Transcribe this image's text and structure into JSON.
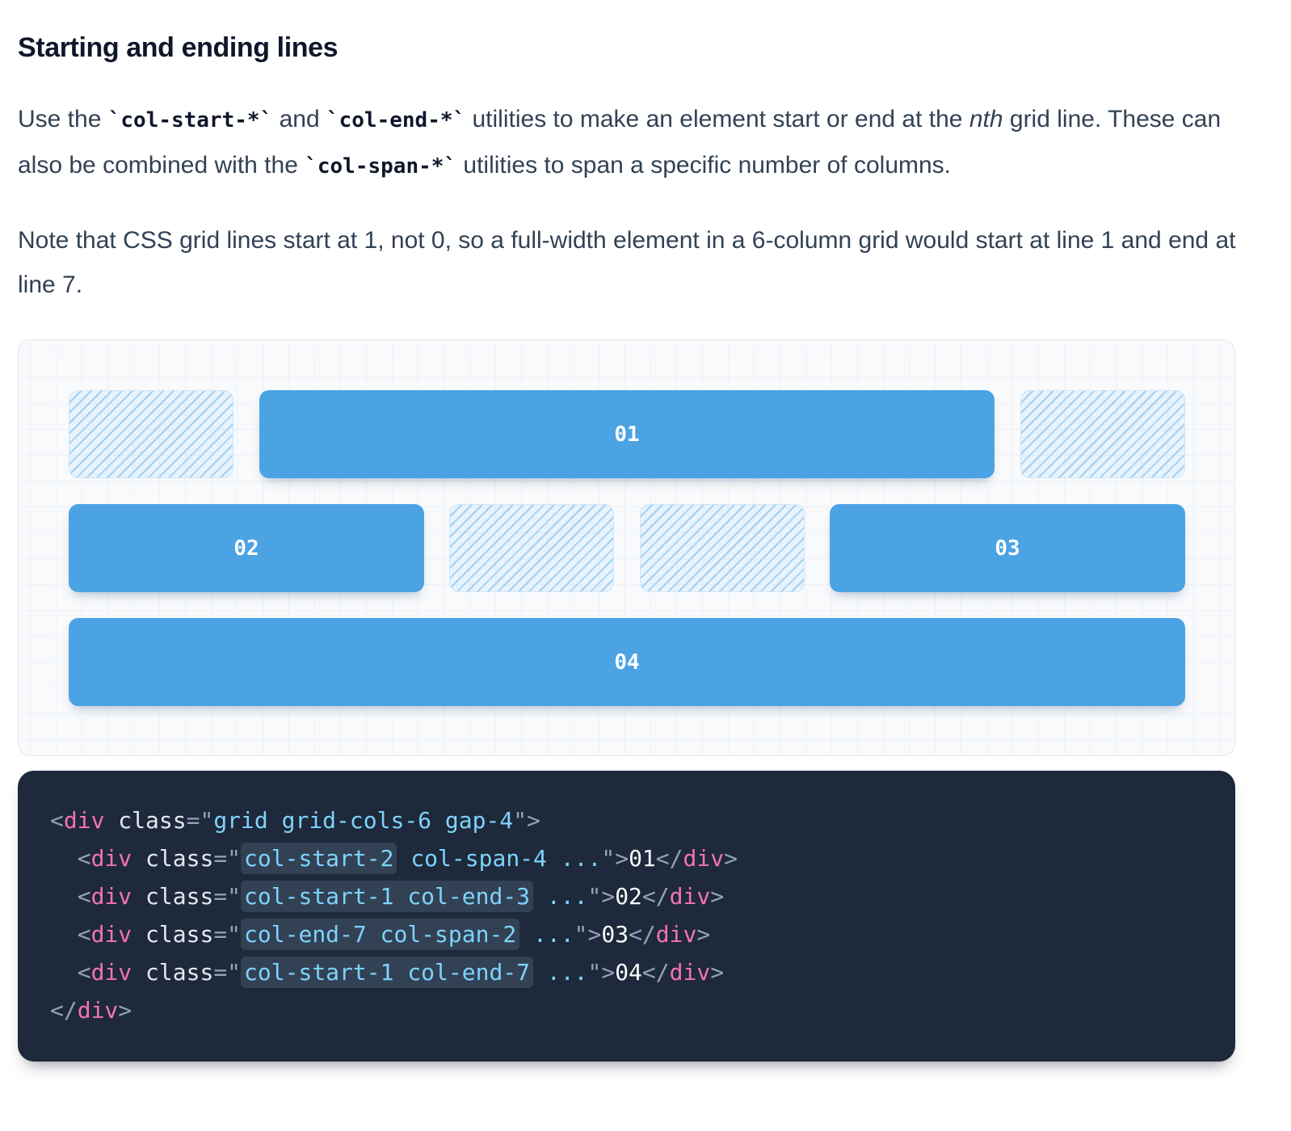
{
  "heading": "Starting and ending lines",
  "intro": {
    "text_use": "Use the ",
    "code_start": "`col-start-*`",
    "text_and": " and ",
    "code_end": "`col-end-*`",
    "text_mid": " utilities to make an element start or end at the ",
    "emph": "nth",
    "text_line": " grid line. These can also be combined with the ",
    "code_span": "`col-span-*`",
    "text_tail": " utilities to span a specific number of columns."
  },
  "note": "Note that CSS grid lines start at 1, not 0, so a full-width element in a 6-column grid would start at line 1 and end at line 7.",
  "demo": {
    "items": [
      "01",
      "02",
      "03",
      "04"
    ],
    "colors": {
      "item": "#4ba3e3",
      "hatch": "#9fd1f5"
    }
  },
  "code": {
    "open_tag": "div",
    "class_attr": "class",
    "outer_class": "grid grid-cols-6 gap-4",
    "rows": [
      {
        "highlight": "col-start-2",
        "rest": " col-span-4 ...",
        "content": "01"
      },
      {
        "highlight": "col-start-1 col-end-3",
        "rest": " ...",
        "content": "02"
      },
      {
        "highlight": "col-end-7 col-span-2",
        "rest": " ...",
        "content": "03"
      },
      {
        "highlight": "col-start-1 col-end-7",
        "rest": " ...",
        "content": "04"
      }
    ]
  }
}
